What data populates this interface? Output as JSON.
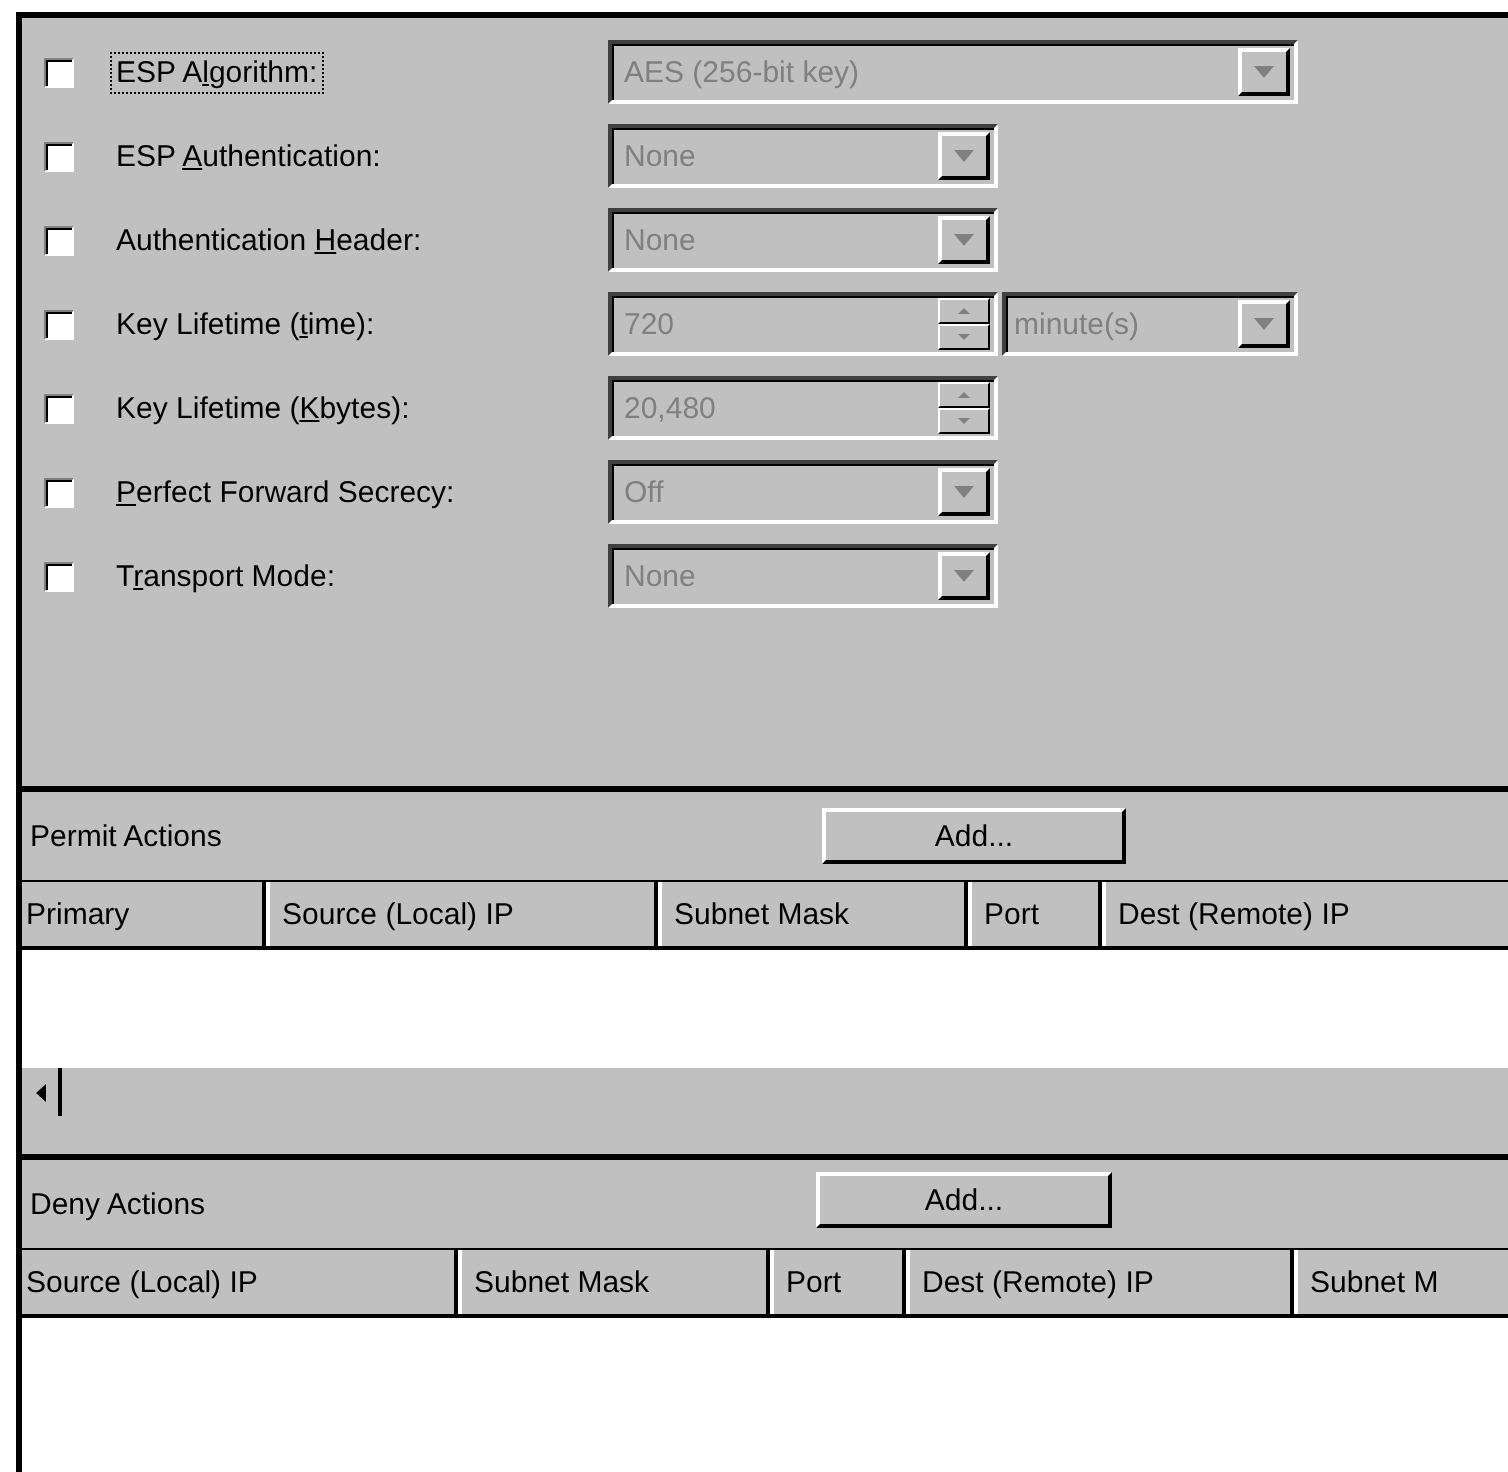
{
  "settings": [
    {
      "checked": false,
      "focused": true,
      "label_parts": [
        {
          "text": "ESP A",
          "underlined": false
        },
        {
          "text": "l",
          "underlined": true
        },
        {
          "text": "gorithm:",
          "underlined": false
        }
      ],
      "kind": "dropdown",
      "wide": true,
      "disabled": true,
      "value": "AES (256-bit key)"
    },
    {
      "checked": false,
      "focused": false,
      "label_parts": [
        {
          "text": "ESP ",
          "underlined": false
        },
        {
          "text": "A",
          "underlined": true
        },
        {
          "text": "uthentication:",
          "underlined": false
        }
      ],
      "kind": "dropdown",
      "wide": false,
      "disabled": true,
      "value": "None"
    },
    {
      "checked": false,
      "focused": false,
      "label_parts": [
        {
          "text": "Authentication ",
          "underlined": false
        },
        {
          "text": "H",
          "underlined": true
        },
        {
          "text": "eader:",
          "underlined": false
        }
      ],
      "kind": "dropdown",
      "wide": false,
      "disabled": true,
      "value": "None"
    },
    {
      "checked": false,
      "focused": false,
      "label_parts": [
        {
          "text": "Key Lifetime (",
          "underlined": false
        },
        {
          "text": "t",
          "underlined": true
        },
        {
          "text": "ime):",
          "underlined": false
        }
      ],
      "kind": "spin",
      "disabled": true,
      "value": "720",
      "unit": "minute(s)"
    },
    {
      "checked": false,
      "focused": false,
      "label_parts": [
        {
          "text": "Key Lifetime (",
          "underlined": false
        },
        {
          "text": "K",
          "underlined": true
        },
        {
          "text": "bytes):",
          "underlined": false
        }
      ],
      "kind": "spin",
      "disabled": true,
      "value": "20,480"
    },
    {
      "checked": false,
      "focused": false,
      "label_parts": [
        {
          "text": "P",
          "underlined": true
        },
        {
          "text": "erfect Forward Secrecy:",
          "underlined": false
        }
      ],
      "kind": "dropdown",
      "wide": false,
      "disabled": true,
      "value": "Off"
    },
    {
      "checked": false,
      "focused": false,
      "label_parts": [
        {
          "text": "T",
          "underlined": false
        },
        {
          "text": "r",
          "underlined": true
        },
        {
          "text": "ansport Mode:",
          "underlined": false
        }
      ],
      "kind": "dropdown",
      "wide": false,
      "disabled": true,
      "value": "None"
    }
  ],
  "permit_actions": {
    "title": "Permit Actions",
    "button": "Add...",
    "columns": [
      "Primary",
      "Source (Local) IP",
      "Subnet Mask",
      "Port",
      "Dest (Remote) IP"
    ]
  },
  "deny_actions": {
    "title": "Deny Actions",
    "button": "Add...",
    "columns": [
      "Source (Local) IP",
      "Subnet Mask",
      "Port",
      "Dest (Remote) IP",
      "Subnet M"
    ]
  }
}
